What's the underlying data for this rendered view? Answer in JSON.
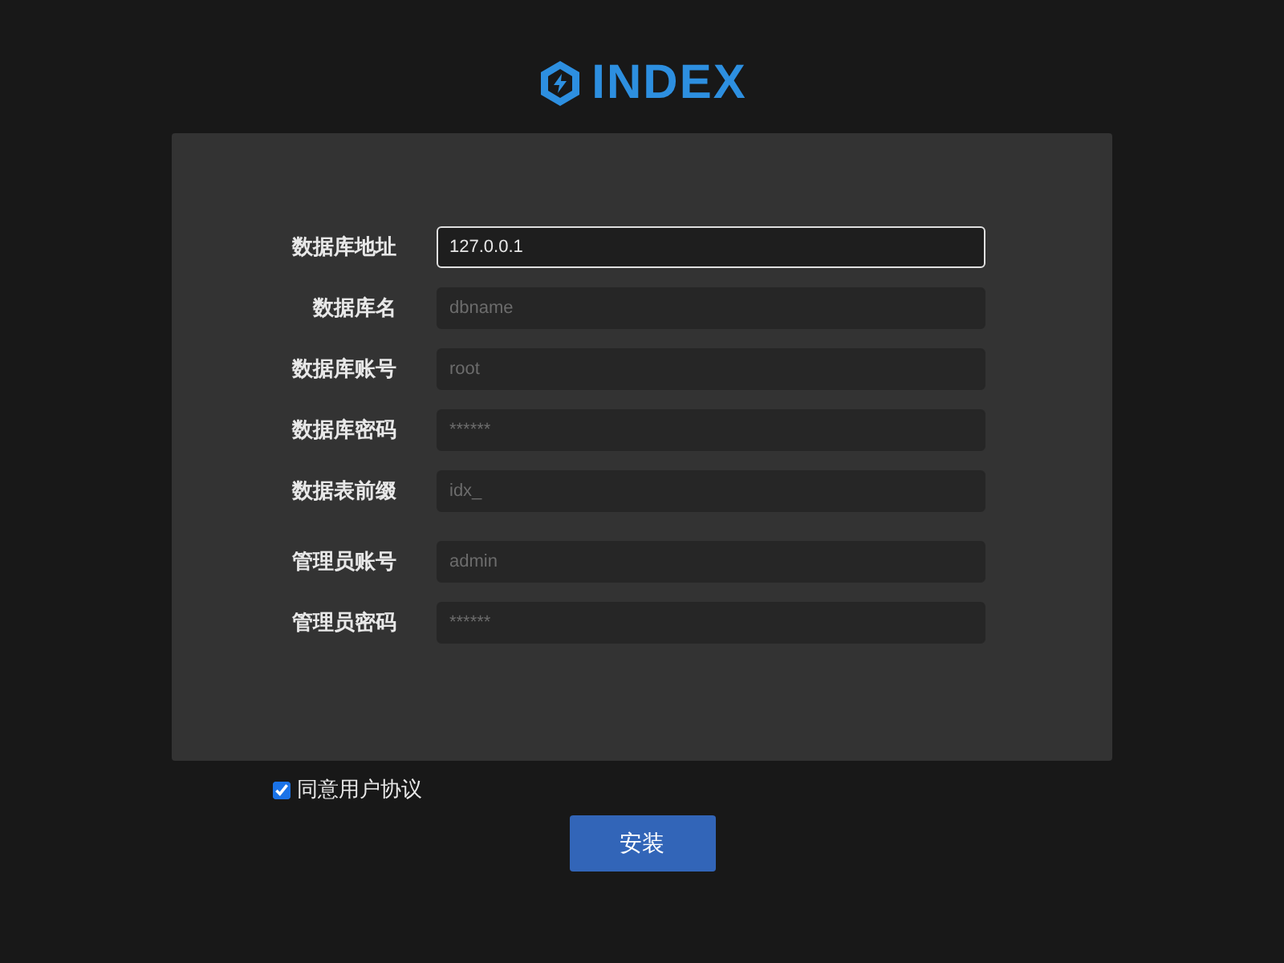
{
  "logo": {
    "text": "INDEX"
  },
  "field_groups": [
    {
      "fields": [
        {
          "label": "数据库地址",
          "value": "127.0.0.1",
          "focused": true
        },
        {
          "label": "数据库名",
          "placeholder": "dbname",
          "focused": false
        },
        {
          "label": "数据库账号",
          "placeholder": "root",
          "focused": false
        },
        {
          "label": "数据库密码",
          "placeholder": "******",
          "focused": false
        },
        {
          "label": "数据表前缀",
          "placeholder": "idx_",
          "focused": false
        }
      ]
    },
    {
      "fields": [
        {
          "label": "管理员账号",
          "placeholder": "admin",
          "focused": false
        },
        {
          "label": "管理员密码",
          "placeholder": "******",
          "focused": false
        }
      ]
    }
  ],
  "agreement": {
    "label": "同意用户协议",
    "checked": true
  },
  "submit": {
    "label": "安装"
  }
}
